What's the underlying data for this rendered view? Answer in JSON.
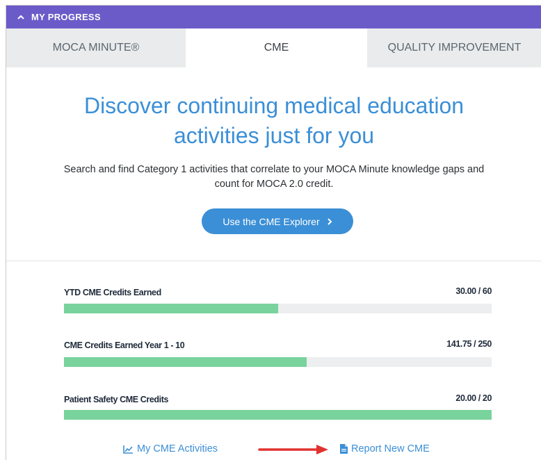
{
  "header": {
    "title": "MY PROGRESS",
    "caret_icon": "chevron-up-icon",
    "color": "#6b5bc9"
  },
  "tabs": [
    {
      "label": "MOCA MINUTE®",
      "active": false
    },
    {
      "label": "CME",
      "active": true
    },
    {
      "label": "QUALITY IMPROVEMENT",
      "active": false
    }
  ],
  "hero": {
    "title_line1": "Discover continuing medical education",
    "title_line2": "activities just for you",
    "description_line1": "Search and find Category 1 activities that correlate to your MOCA Minute knowledge gaps and",
    "description_line2": "count for MOCA 2.0 credit.",
    "button_label": "Use the CME Explorer",
    "accent_color": "#3b8fd6"
  },
  "progress": [
    {
      "label": "YTD CME Credits Earned",
      "value_text": "30.00 / 60",
      "earned": 30.0,
      "total": 60
    },
    {
      "label": "CME Credits Earned Year 1 - 10",
      "value_text": "141.75 / 250",
      "earned": 141.75,
      "total": 250
    },
    {
      "label": "Patient Safety CME Credits",
      "value_text": "20.00 / 20",
      "earned": 20.0,
      "total": 20
    }
  ],
  "progress_fill_color": "#78d39c",
  "footer": {
    "activities_label": "My CME Activities",
    "activities_icon": "line-chart-icon",
    "report_label": "Report New CME",
    "report_icon": "document-icon",
    "arrow_color": "#e0322f"
  }
}
